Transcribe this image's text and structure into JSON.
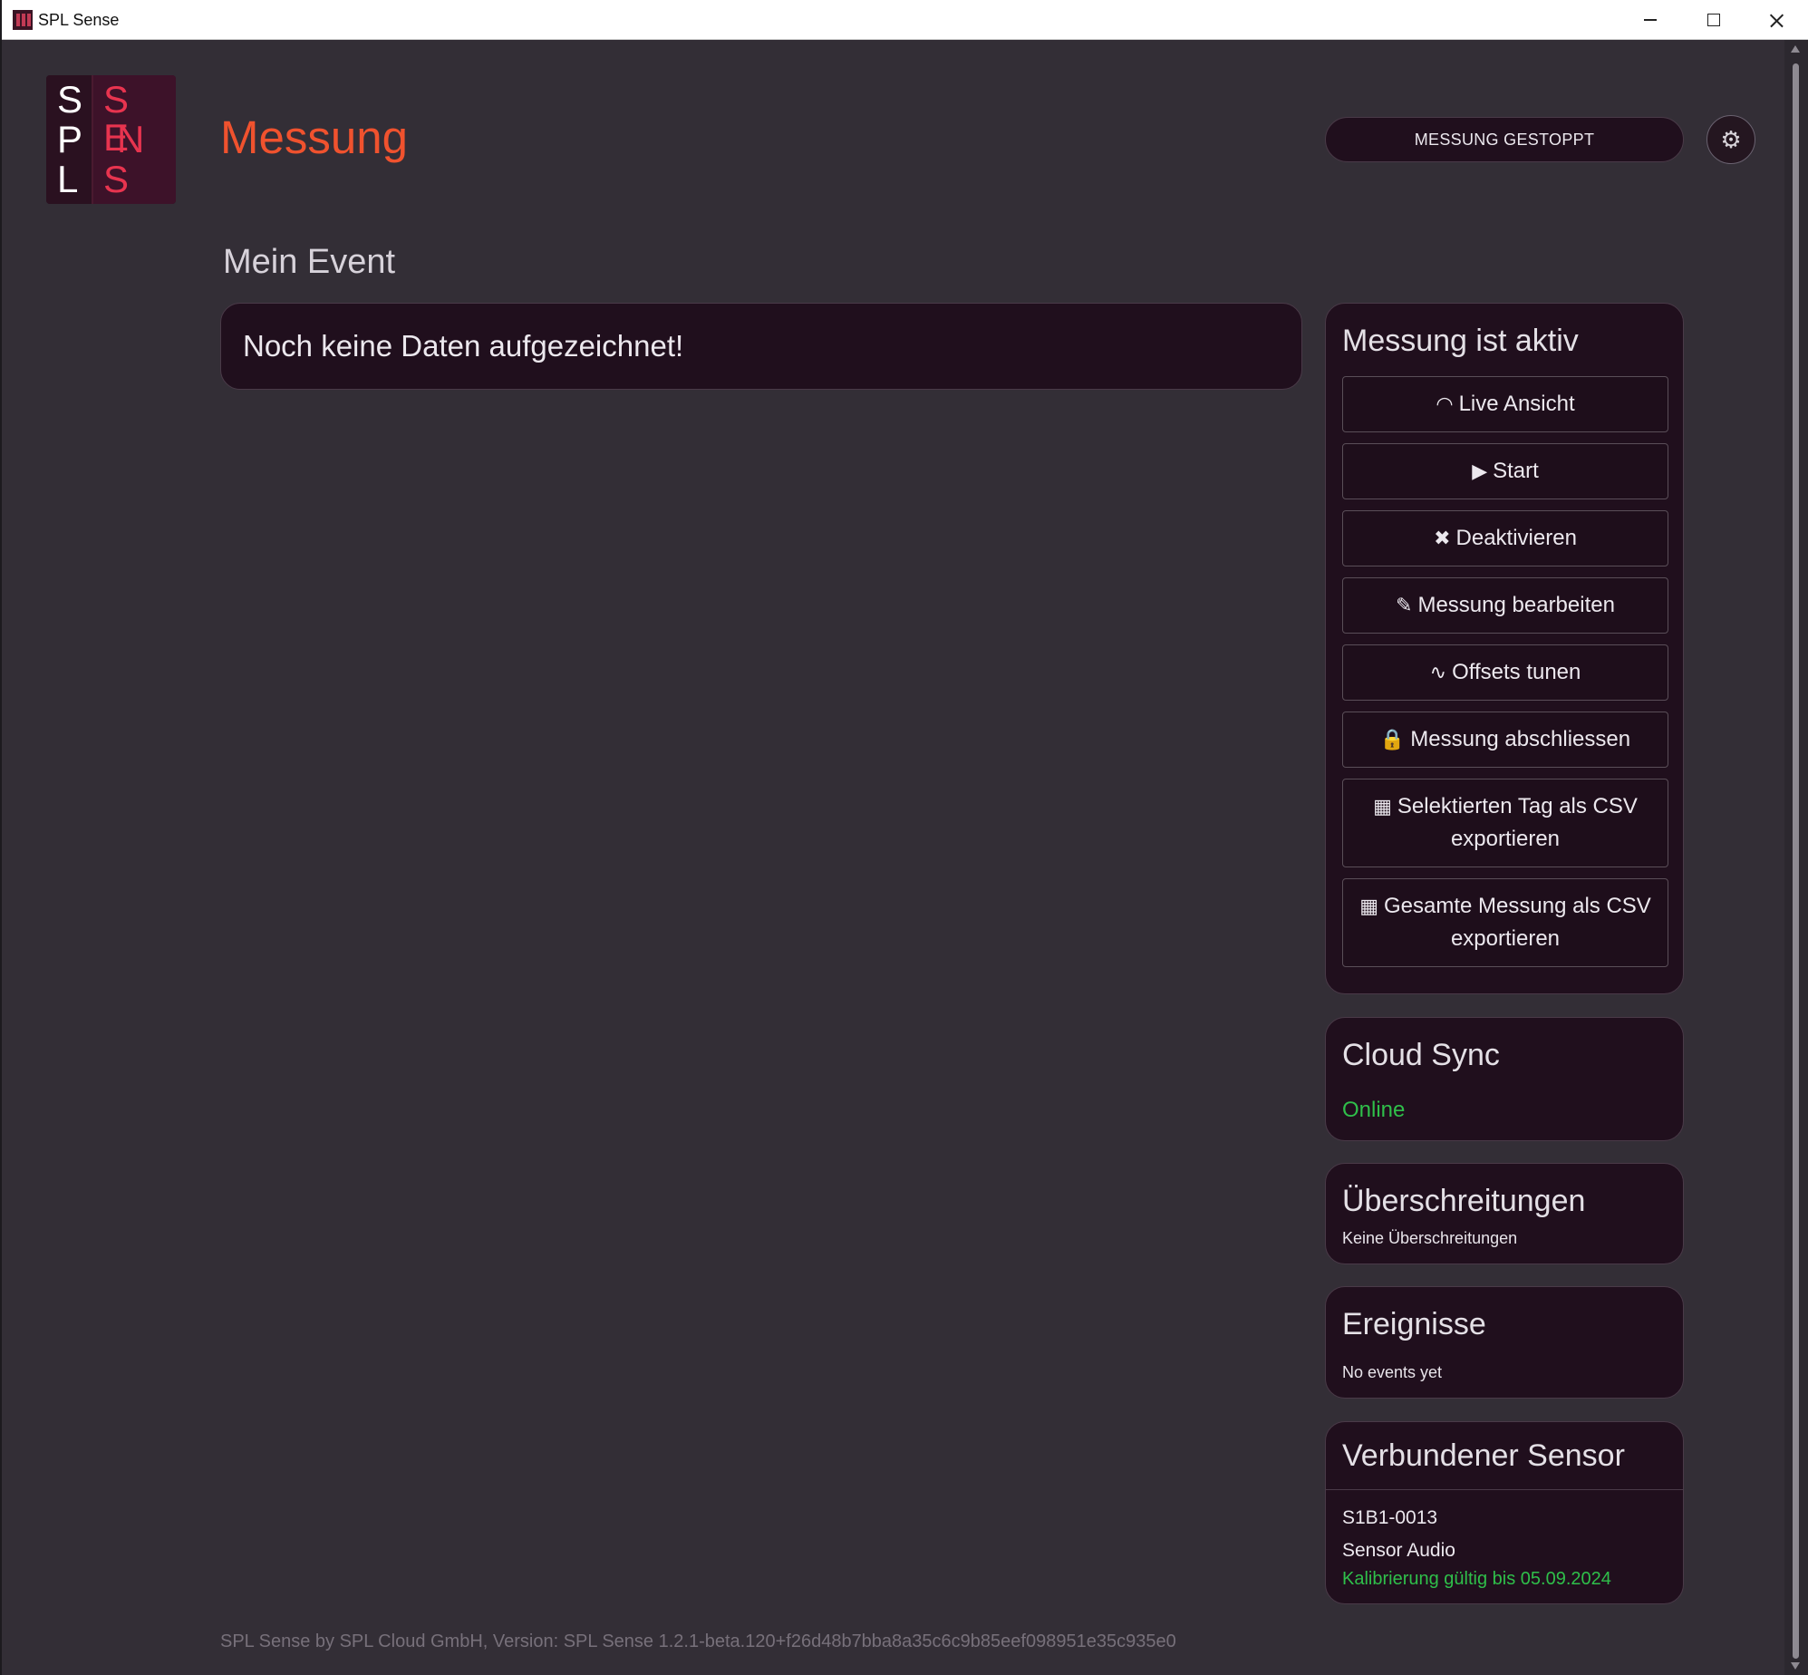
{
  "window": {
    "title": "SPL Sense"
  },
  "logo": {
    "left_letters": [
      "S",
      "P",
      "L"
    ],
    "right_rows": [
      "S E",
      "N",
      "S E"
    ],
    "text": "SPL SENSE"
  },
  "header": {
    "title": "Messung",
    "status_label": "MESSUNG GESTOPPT",
    "settings_icon": "gear-icon"
  },
  "event": {
    "name": "Mein Event"
  },
  "main": {
    "empty_message": "Noch keine Daten aufgezeichnet!"
  },
  "actions": {
    "title": "Messung ist aktiv",
    "buttons": [
      {
        "label": "Live Ansicht",
        "icon": "gauge-icon",
        "glyph": "◠"
      },
      {
        "label": "Start",
        "icon": "play-icon",
        "glyph": "▶"
      },
      {
        "label": "Deaktivieren",
        "icon": "close-icon",
        "glyph": "✖"
      },
      {
        "label": "Messung bearbeiten",
        "icon": "pencil-icon",
        "glyph": "✎"
      },
      {
        "label": "Offsets tunen",
        "icon": "waveform-icon",
        "glyph": "∿"
      },
      {
        "label": "Messung abschliessen",
        "icon": "lock-icon",
        "glyph": "🔒"
      },
      {
        "label": "Selektierten Tag als CSV exportieren",
        "icon": "table-icon",
        "glyph": "▦"
      },
      {
        "label": "Gesamte Messung als CSV exportieren",
        "icon": "table-icon",
        "glyph": "▦"
      }
    ]
  },
  "cloud_sync": {
    "title": "Cloud Sync",
    "status": "Online",
    "status_color": "#2fbf4a"
  },
  "exceedances": {
    "title": "Überschreitungen",
    "text": "Keine Überschreitungen"
  },
  "events": {
    "title": "Ereignisse",
    "text": "No events yet"
  },
  "sensor": {
    "title": "Verbundener Sensor",
    "id": "S1B1-0013",
    "type": "Sensor Audio",
    "calibration": "Kalibrierung gültig bis 05.09.2024"
  },
  "footer": {
    "version": "SPL Sense by SPL Cloud GmbH, Version: SPL Sense 1.2.1-beta.120+f26d48b7bba8a35c6c9b85eef098951e35c935e0"
  },
  "colors": {
    "accent": "#f0522e",
    "brand_red": "#e8344f",
    "background": "#332e36",
    "card": "#200f1d",
    "success": "#2fbf4a"
  }
}
